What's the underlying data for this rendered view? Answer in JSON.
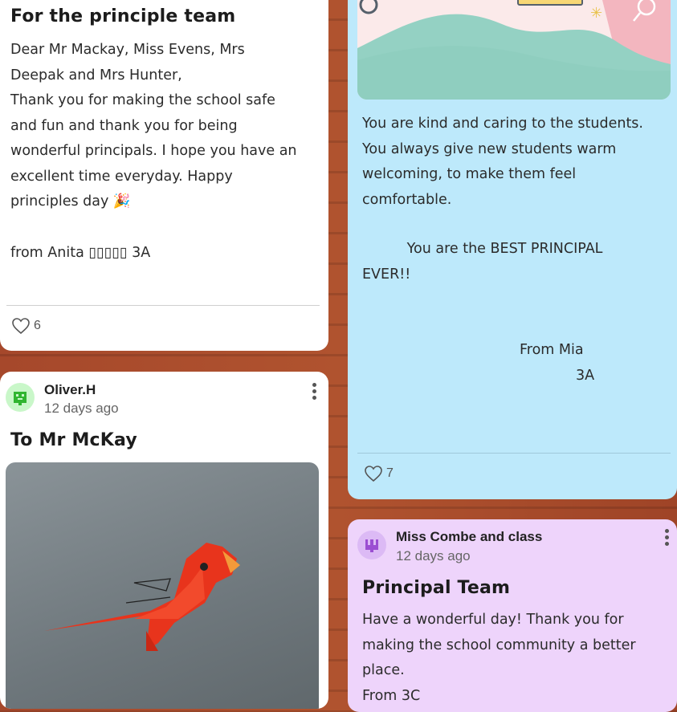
{
  "cards": {
    "principle": {
      "title": "For the principle team",
      "body": "Dear Mr Mackay, Miss Evens, Mrs\nDeepak and Mrs Hunter,\nThank you for making the school safe\nand fun and thank you for being\nwonderful principals. I hope you have an\nexcellent time everyday. Happy\nprinciples day 🎉",
      "from": "from Anita ▯▯▯▯▯ 3A",
      "likes": "6"
    },
    "mia": {
      "body": "You are kind and caring to the students.\nYou always give new students warm\nwelcoming, to make them feel\ncomfortable.",
      "best": "          You are the BEST PRINCIPAL\nEVER!!",
      "from_line1": "From Mia",
      "from_line2": "3A",
      "likes": "7"
    },
    "oliver": {
      "author": "Oliver.H",
      "time": "12 days ago",
      "title": "To Mr McKay"
    },
    "combe": {
      "author": "Miss Combe and class",
      "time": "12 days ago",
      "title": "Principal Team",
      "body": "Have a wonderful day! Thank you for\nmaking the school community a better\nplace.",
      "cutoff": "From 3C"
    }
  },
  "colors": {
    "card_blue": "#bde9fb",
    "card_purple": "#eed4fb",
    "avatar_green": "#3fbf3f",
    "avatar_purple": "#9b59d0",
    "brick": "#a44a2c"
  },
  "icons": {
    "like": "heart-outline-icon",
    "more": "vertical-dots-icon"
  }
}
